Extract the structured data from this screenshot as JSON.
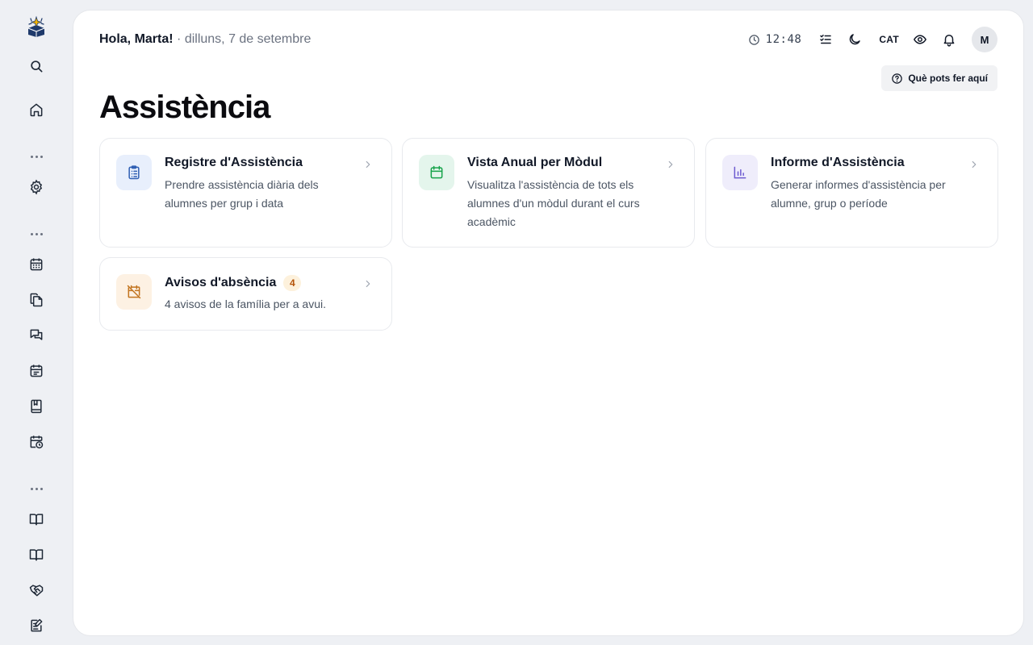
{
  "header": {
    "greeting": "Hola, Marta!",
    "separator": "·",
    "date": "dilluns, 7 de setembre",
    "time": "12:48",
    "language": "CAT",
    "avatar_initial": "M",
    "help_label": "Què pots fer aquí"
  },
  "page": {
    "title": "Assistència"
  },
  "cards": [
    {
      "title": "Registre d'Assistència",
      "description": "Prendre assistència diària dels alumnes per grup i data",
      "icon": "clipboard-list-icon",
      "icon_bg": "#e8effc",
      "icon_color": "#2f5fb3"
    },
    {
      "title": "Vista Anual per Mòdul",
      "description": "Visualitza l'assistència de tots els alumnes d'un mòdul durant el curs acadèmic",
      "icon": "calendar-icon",
      "icon_bg": "#e4f5ec",
      "icon_color": "#16a34a"
    },
    {
      "title": "Informe d'Assistència",
      "description": "Generar informes d'assistència per alumne, grup o període",
      "icon": "bar-chart-icon",
      "icon_bg": "#efedfb",
      "icon_color": "#6d5bd0"
    },
    {
      "title": "Avisos d'absència",
      "badge": "4",
      "description": "4 avisos de la família per a avui.",
      "icon": "calendar-off-icon",
      "icon_bg": "#fdf1e3",
      "icon_color": "#c2741f"
    }
  ],
  "sidebar": {
    "icons": [
      "logo-icon",
      "search-icon",
      "home-icon",
      "settings-icon",
      "calendar-grid-icon",
      "files-icon",
      "chat-icon",
      "calendar-list-icon",
      "bookmark-book-icon",
      "calendar-clock-icon",
      "book-open-icon",
      "book-open-icon",
      "handshake-icon",
      "edit-note-icon"
    ]
  }
}
